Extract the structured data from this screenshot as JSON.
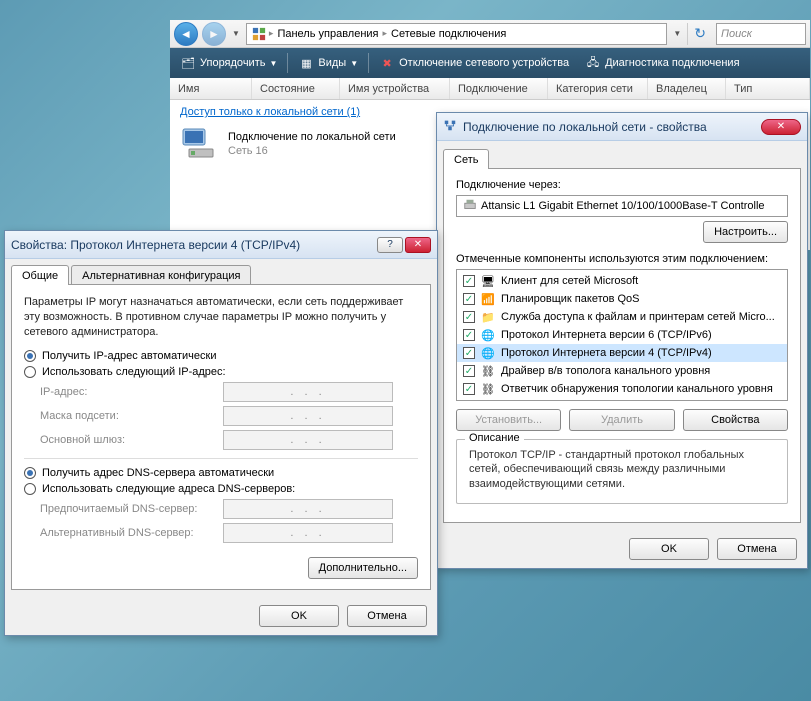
{
  "explorer": {
    "breadcrumb": {
      "item1": "Панель управления",
      "item2": "Сетевые подключения"
    },
    "search_placeholder": "Поиск",
    "toolbar": {
      "organize": "Упорядочить",
      "views": "Виды",
      "disable": "Отключение сетевого устройства",
      "diagnose": "Диагностика подключения"
    },
    "columns": {
      "name": "Имя",
      "status": "Состояние",
      "device": "Имя устройства",
      "connection": "Подключение",
      "category": "Категория сети",
      "owner": "Владелец",
      "type": "Тип"
    },
    "group": "Доступ только к локальной сети (1)",
    "item": {
      "title": "Подключение по локальной сети",
      "subtitle": "Сеть 16"
    }
  },
  "tcpip": {
    "window_title": "Свойства: Протокол Интернета версии 4 (TCP/IPv4)",
    "tab_general": "Общие",
    "tab_alt": "Альтернативная конфигурация",
    "description": "Параметры IP могут назначаться автоматически, если сеть поддерживает эту возможность. В противном случае параметры IP можно получить у сетевого администратора.",
    "radio_ip_auto": "Получить IP-адрес автоматически",
    "radio_ip_manual": "Использовать следующий IP-адрес:",
    "label_ip": "IP-адрес:",
    "label_mask": "Маска подсети:",
    "label_gateway": "Основной шлюз:",
    "radio_dns_auto": "Получить адрес DNS-сервера автоматически",
    "radio_dns_manual": "Использовать следующие адреса DNS-серверов:",
    "label_dns1": "Предпочитаемый DNS-сервер:",
    "label_dns2": "Альтернативный DNS-сервер:",
    "ip_dots": ".     .     .",
    "btn_advanced": "Дополнительно...",
    "btn_ok": "OK",
    "btn_cancel": "Отмена"
  },
  "lan": {
    "window_title": "Подключение по локальной сети - свойства",
    "tab_net": "Сеть",
    "connect_using": "Подключение через:",
    "adapter": "Attansic L1 Gigabit Ethernet 10/100/1000Base-T Controlle",
    "btn_configure": "Настроить...",
    "components_label": "Отмеченные компоненты используются этим подключением:",
    "components": [
      "Клиент для сетей Microsoft",
      "Планировщик пакетов QoS",
      "Служба доступа к файлам и принтерам сетей Micro...",
      "Протокол Интернета версии 6 (TCP/IPv6)",
      "Протокол Интернета версии 4 (TCP/IPv4)",
      "Драйвер в/в тополога канального уровня",
      "Ответчик обнаружения топологии канального уровня"
    ],
    "btn_install": "Установить...",
    "btn_remove": "Удалить",
    "btn_properties": "Свойства",
    "desc_legend": "Описание",
    "description": "Протокол TCP/IP - стандартный протокол глобальных сетей, обеспечивающий связь между различными взаимодействующими сетями.",
    "btn_ok": "OK",
    "btn_cancel": "Отмена",
    "close_icon": "✕"
  }
}
